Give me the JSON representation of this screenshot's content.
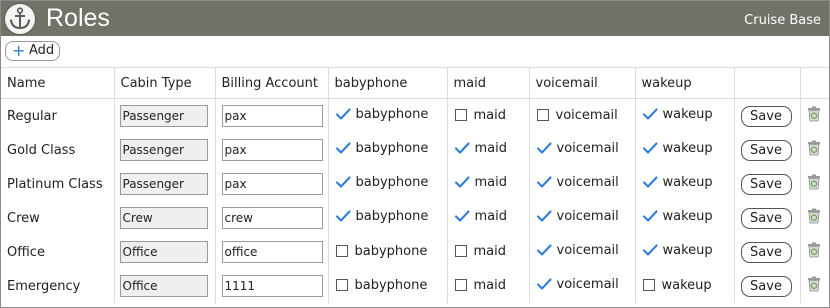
{
  "header": {
    "title": "Roles",
    "brand": "Cruise Base",
    "logo_icon": "anchor-icon"
  },
  "toolbar": {
    "add_label": "Add",
    "add_icon": "plus-icon"
  },
  "columns": [
    "Name",
    "Cabin Type",
    "Billing Account",
    "babyphone",
    "maid",
    "voicemail",
    "wakeup"
  ],
  "perm_labels": [
    "babyphone",
    "maid",
    "voicemail",
    "wakeup"
  ],
  "save_label": "Save",
  "colors": {
    "header_bg": "#727269",
    "check": "#2f7fd6",
    "trash_green": "#6aa84f"
  },
  "rows": [
    {
      "name": "Regular",
      "cabin_type": "Passenger",
      "billing": "pax",
      "perms": [
        true,
        false,
        false,
        true
      ]
    },
    {
      "name": "Gold Class",
      "cabin_type": "Passenger",
      "billing": "pax",
      "perms": [
        true,
        true,
        true,
        true
      ]
    },
    {
      "name": "Platinum Class",
      "cabin_type": "Passenger",
      "billing": "pax",
      "perms": [
        true,
        true,
        true,
        true
      ]
    },
    {
      "name": "Crew",
      "cabin_type": "Crew",
      "billing": "crew",
      "perms": [
        true,
        true,
        true,
        true
      ]
    },
    {
      "name": "Office",
      "cabin_type": "Office",
      "billing": "office",
      "perms": [
        false,
        false,
        true,
        true
      ]
    },
    {
      "name": "Emergency",
      "cabin_type": "Office",
      "billing": "1111",
      "perms": [
        false,
        false,
        true,
        false
      ]
    }
  ]
}
